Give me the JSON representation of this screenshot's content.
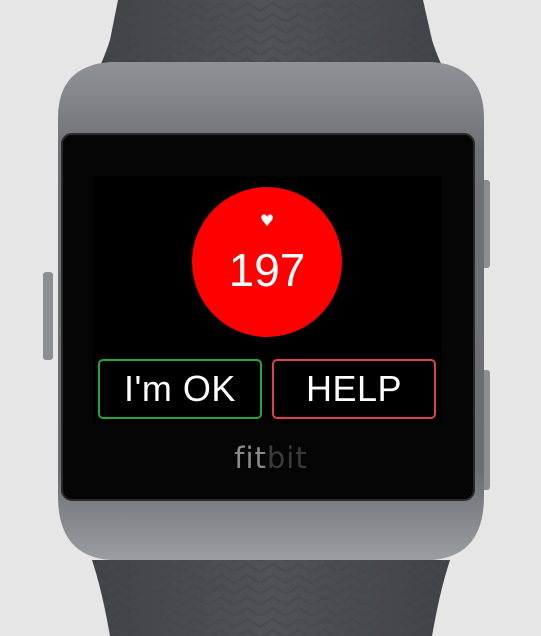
{
  "screen": {
    "heart_icon": "heart-icon",
    "heart_rate": "197",
    "accent_color": "#ff0000"
  },
  "buttons": {
    "ok_label": "I'm OK",
    "help_label": "HELP",
    "ok_color": "#22a83a",
    "help_color": "#e0404a"
  },
  "device": {
    "brand_part1": "fit",
    "brand_part2": "bit"
  }
}
